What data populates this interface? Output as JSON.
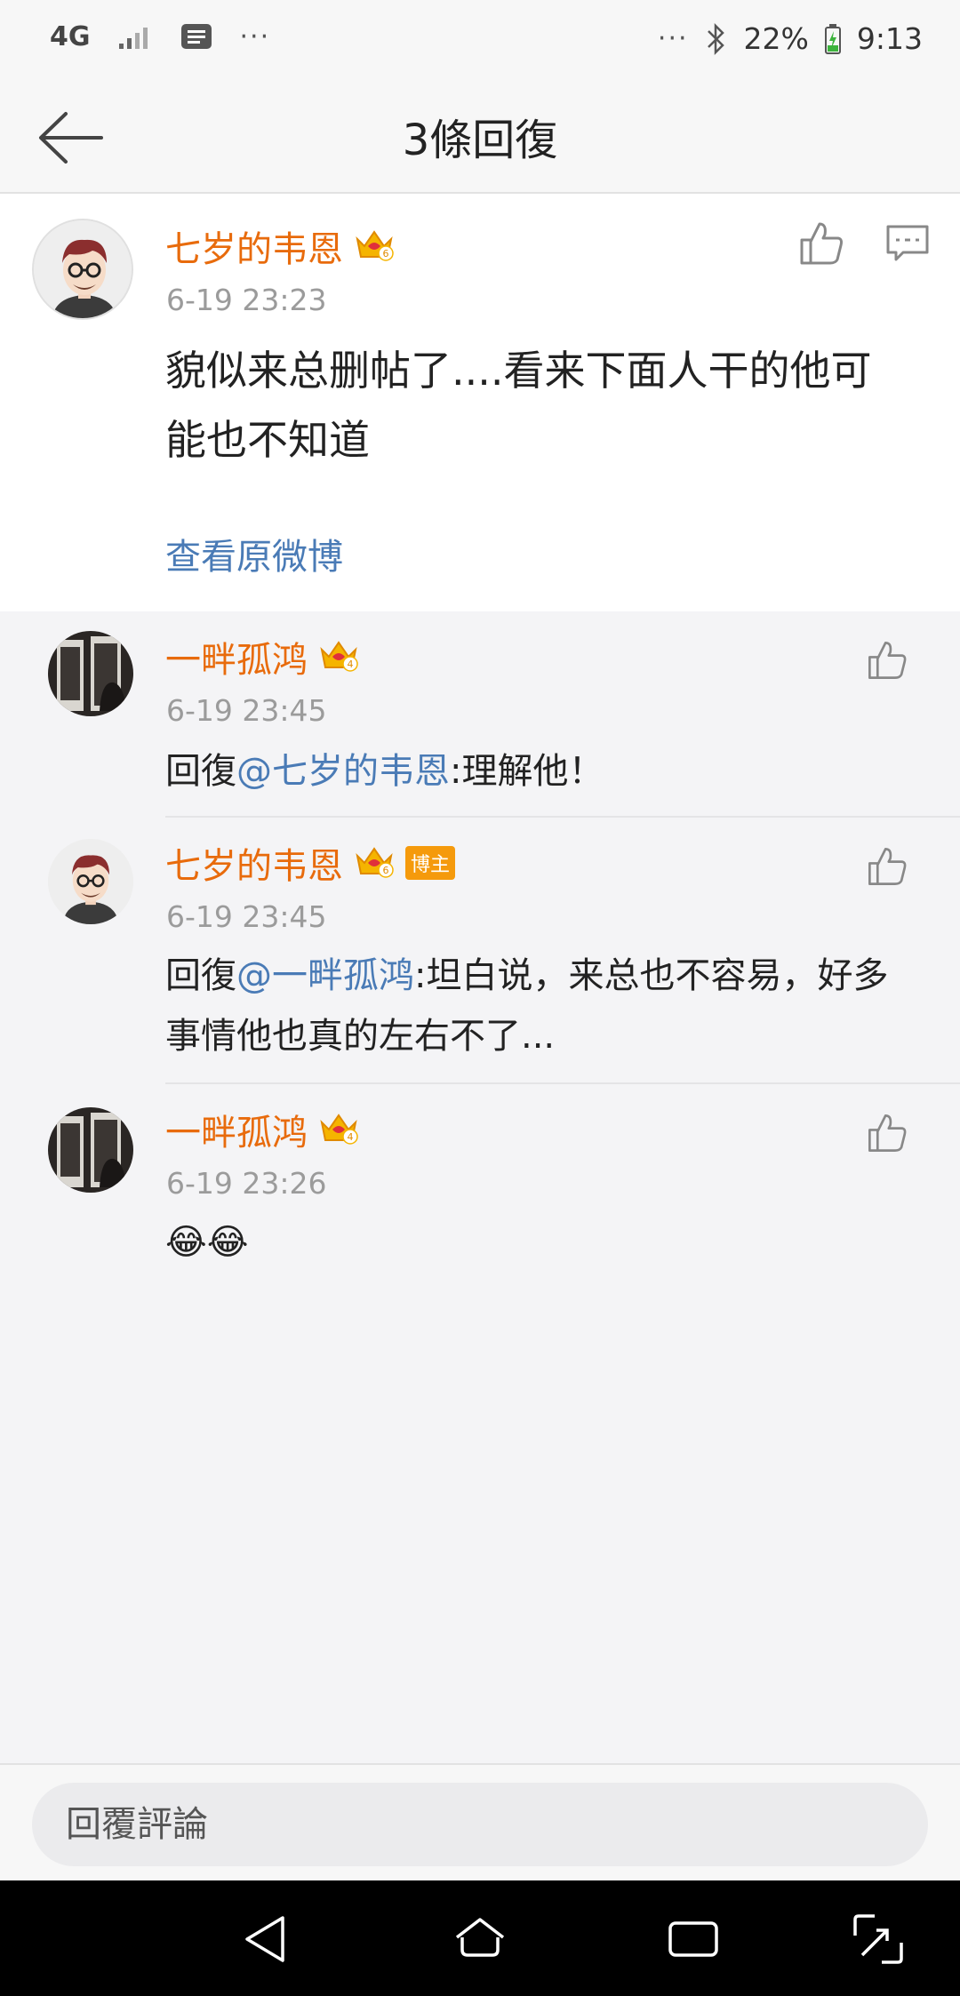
{
  "status_bar": {
    "network": "4G",
    "more_left": "···",
    "more_right": "···",
    "battery": "22%",
    "time": "9:13"
  },
  "nav": {
    "title": "3條回復"
  },
  "main_comment": {
    "username": "七岁的韦恩",
    "level": "6",
    "time": "6-19 23:23",
    "text": "貌似来总删帖了....看来下面人干的他可能也不知道",
    "view_original": "查看原微博"
  },
  "replies": [
    {
      "username": "一畔孤鸿",
      "level": "4",
      "time": "6-19 23:45",
      "prefix": "回復",
      "mention": "@七岁的韦恩",
      "text": ":理解他！"
    },
    {
      "username": "七岁的韦恩",
      "level": "6",
      "badge": "博主",
      "time": "6-19 23:45",
      "prefix": "回復",
      "mention": "@一畔孤鸿",
      "text": ":坦白说，来总也不容易，好多事情他也真的左右不了..."
    },
    {
      "username": "一畔孤鸿",
      "level": "4",
      "time": "6-19 23:26",
      "emoji": "😂😂"
    }
  ],
  "input": {
    "placeholder": "回覆評論"
  },
  "colors": {
    "username": "#e86b0c",
    "link": "#4a7bb6",
    "time": "#9b9b9b"
  }
}
